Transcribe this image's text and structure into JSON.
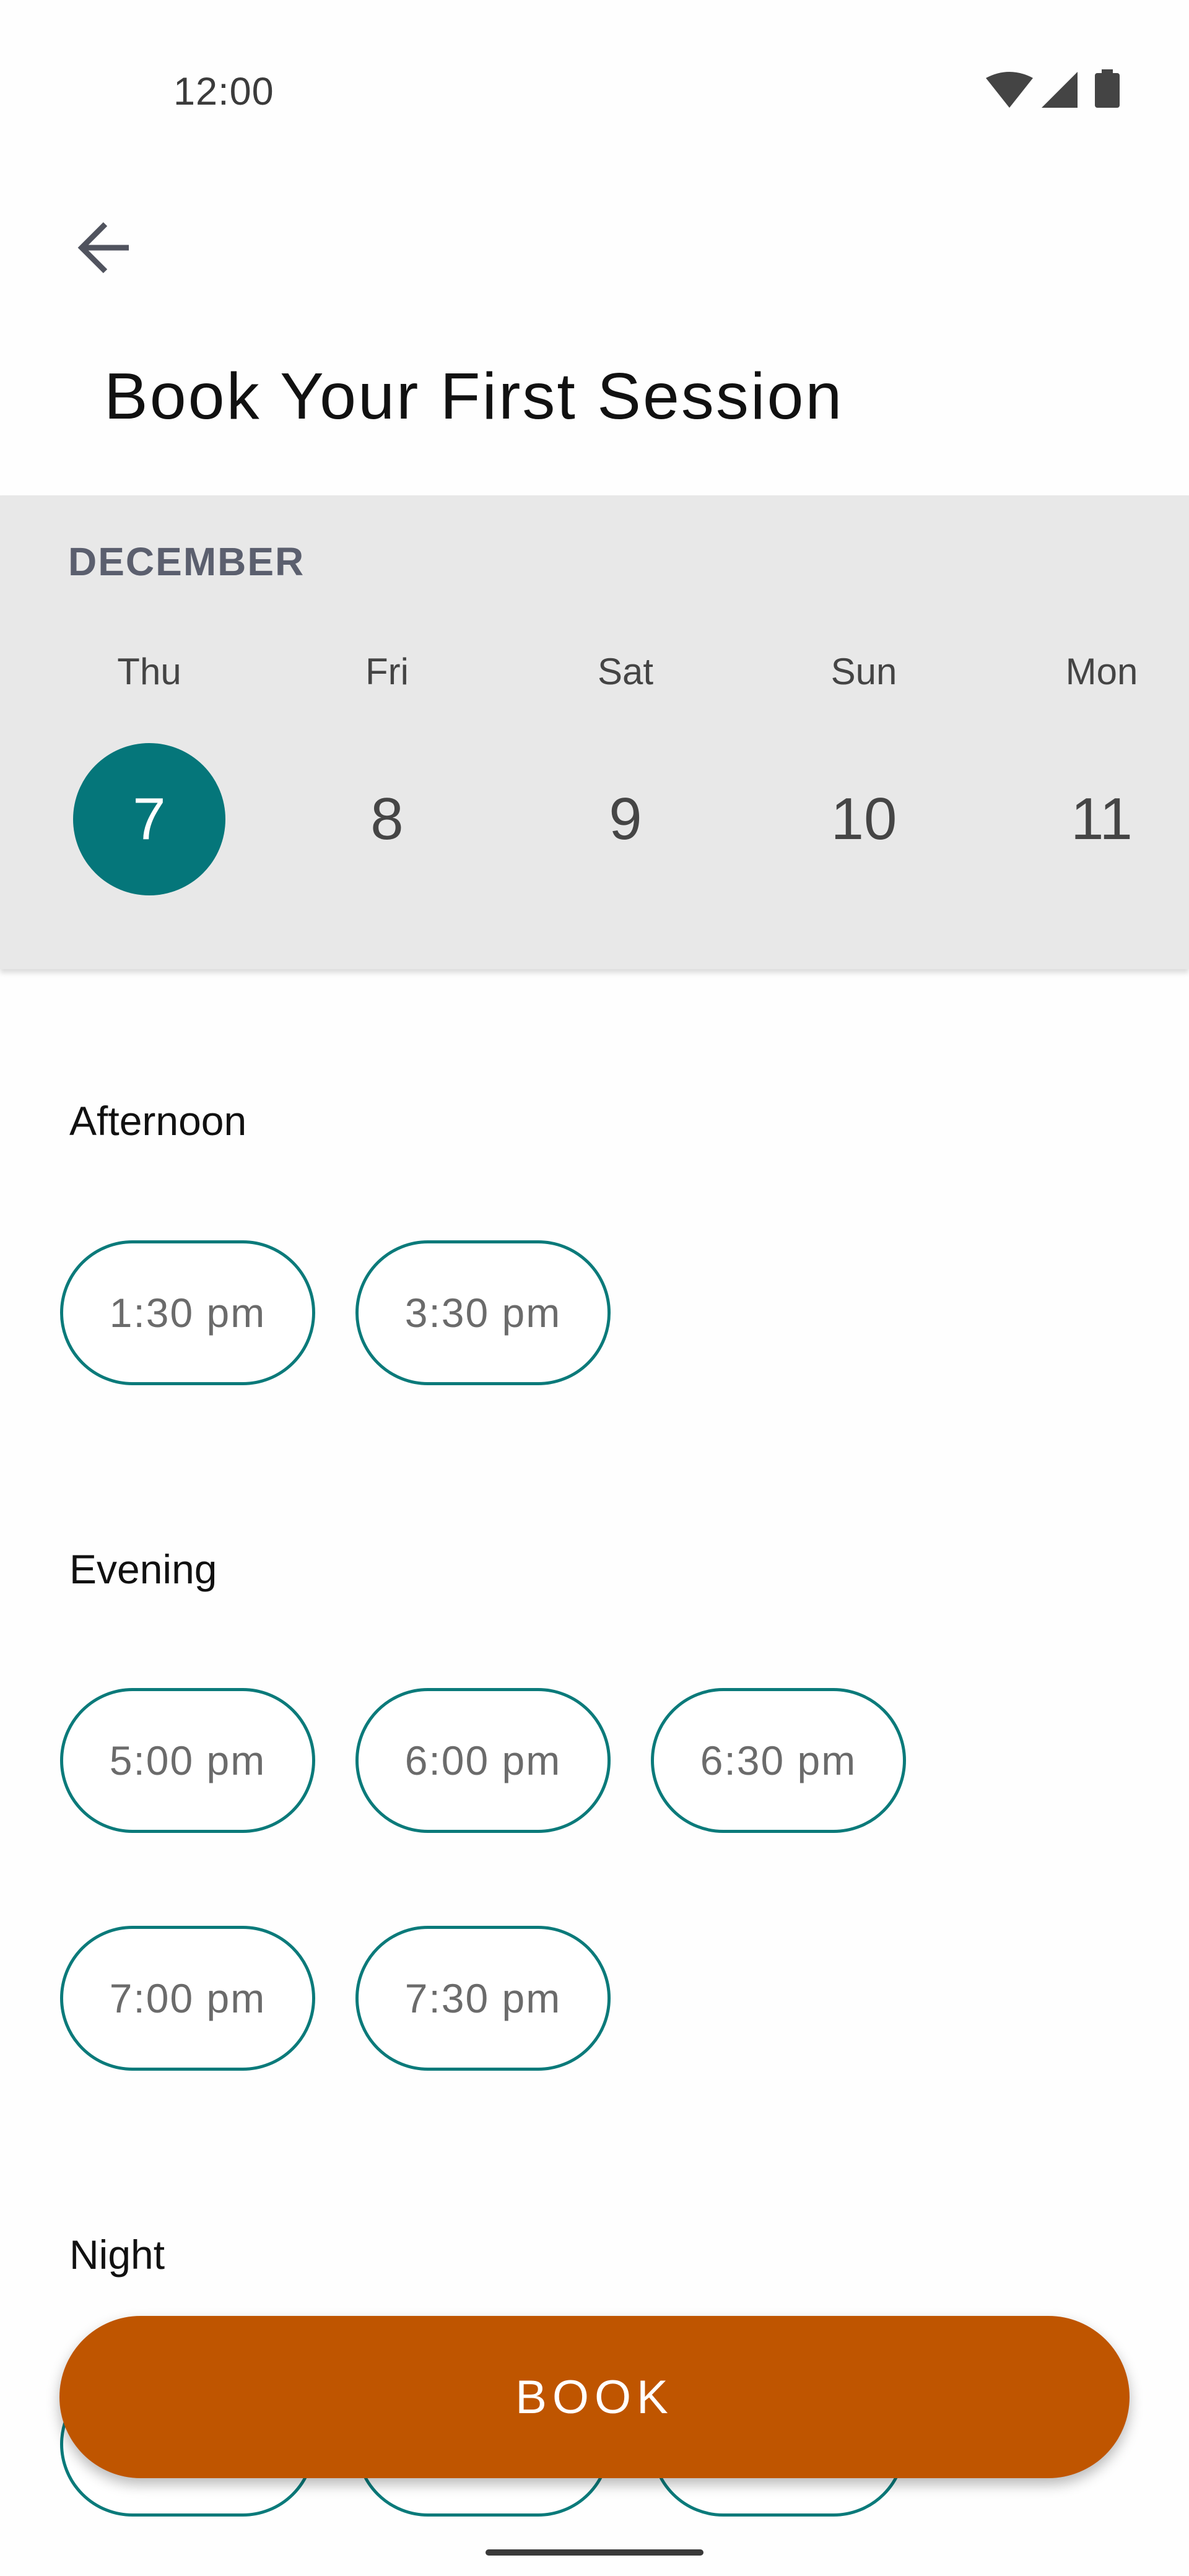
{
  "status_bar": {
    "time": "12:00",
    "icons": [
      "wifi-icon",
      "cellular-signal-icon",
      "battery-icon"
    ]
  },
  "header": {
    "back_icon": "arrow-back-icon",
    "title": "Book Your First Session"
  },
  "calendar": {
    "month": "DECEMBER",
    "days": [
      {
        "name": "Thu",
        "number": "7",
        "selected": true
      },
      {
        "name": "Fri",
        "number": "8",
        "selected": false
      },
      {
        "name": "Sat",
        "number": "9",
        "selected": false
      },
      {
        "name": "Sun",
        "number": "10",
        "selected": false
      },
      {
        "name": "Mon",
        "number": "11",
        "selected": false
      }
    ]
  },
  "sections": {
    "afternoon": {
      "title": "Afternoon",
      "slots": [
        "1:30 pm",
        "3:30 pm"
      ]
    },
    "evening": {
      "title": "Evening",
      "slots": [
        "5:00 pm",
        "6:00 pm",
        "6:30 pm",
        "7:00 pm",
        "7:30 pm"
      ]
    },
    "night": {
      "title": "Night"
    }
  },
  "book_button": {
    "label": "BOOK"
  },
  "colors": {
    "accent_teal": "#05767a",
    "slot_border": "#0b7a7a",
    "book_orange": "#bf5500",
    "calendar_band": "#e8e8e8"
  }
}
